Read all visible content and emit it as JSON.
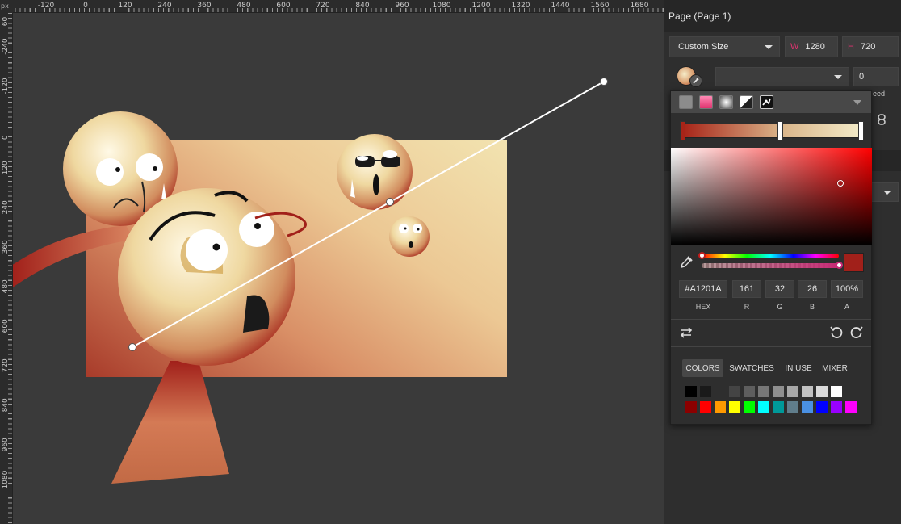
{
  "ruler": {
    "unit": "px",
    "top_labels": [
      "-120",
      "0",
      "120",
      "240",
      "360",
      "480",
      "600",
      "720",
      "840",
      "960",
      "1080",
      "1200",
      "1320",
      "1440",
      "1560",
      "1680"
    ],
    "left_labels": [
      "60",
      "-240",
      "-120",
      "0",
      "120",
      "240",
      "360",
      "480",
      "600",
      "720",
      "840",
      "960",
      "1080"
    ]
  },
  "panel": {
    "title": "Page (Page 1)",
    "size_preset": "Custom Size",
    "width_prefix": "W",
    "width_value": "1280",
    "height_prefix": "H",
    "height_value": "720",
    "bg_value": "0",
    "partial_label": "eed"
  },
  "color_picker": {
    "hex": "#A1201A",
    "r": "161",
    "g": "32",
    "b": "26",
    "a": "100%",
    "labels": {
      "hex": "HEX",
      "r": "R",
      "g": "G",
      "b": "B",
      "a": "A"
    },
    "current_color": "#a1201a",
    "tabs": [
      "COLORS",
      "SWATCHES",
      "IN USE",
      "MIXER"
    ],
    "active_tab": "COLORS",
    "swatches_row1": [
      "#000000",
      "#1a1a1a",
      "#2e2e2e",
      "#444444",
      "#5e5e5e",
      "#777777",
      "#8f8f8f",
      "#a8a8a8",
      "#c2c2c2",
      "#dbdbdb",
      "#ffffff"
    ],
    "swatches_row2": [
      "#8b0000",
      "#ff0000",
      "#ff9900",
      "#ffff00",
      "#00ff00",
      "#00ffff",
      "#009999",
      "#607d8b",
      "#4a90e2",
      "#0000ff",
      "#9900ff",
      "#ff00ff"
    ]
  }
}
